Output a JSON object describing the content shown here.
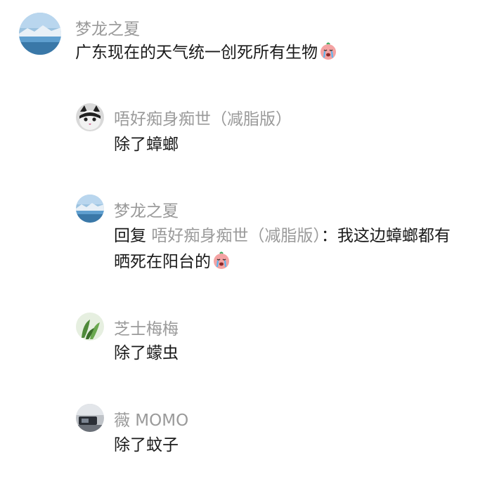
{
  "comments": [
    {
      "name": "梦龙之夏",
      "text": "广东现在的天气统一创死所有生物",
      "emoji": "crying-face-emoji"
    },
    {
      "name": "唔好痴身痴世（减脂版）",
      "text": "除了蟑螂"
    },
    {
      "name": "梦龙之夏",
      "reply_prefix": "回复",
      "reply_target": "唔好痴身痴世（减脂版）",
      "text_line1": "：我这边蟑螂都有",
      "text_line2": "晒死在阳台的",
      "emoji": "crying-face-emoji"
    },
    {
      "name": "芝士梅梅",
      "text": "除了蠓虫"
    },
    {
      "name": "薇 MOMO",
      "text": "除了蚊子"
    }
  ],
  "colors": {
    "name": "#9a9a9a",
    "text": "#1a1a1a",
    "background": "#ffffff"
  }
}
